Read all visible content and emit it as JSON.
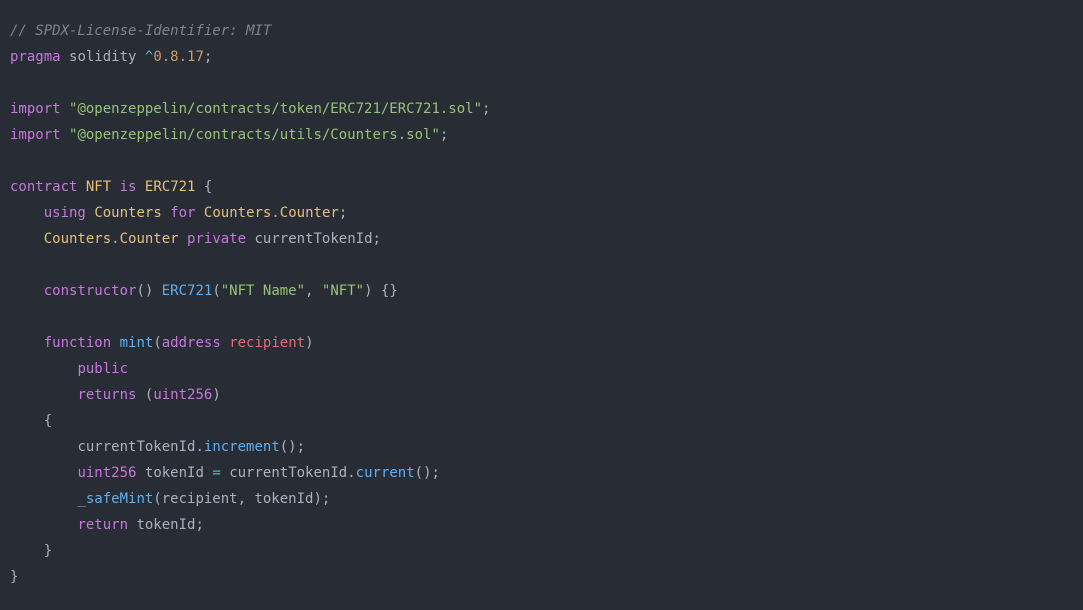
{
  "code": {
    "l1": {
      "comment": "// SPDX-License-Identifier: MIT"
    },
    "l2": {
      "kw1": "pragma",
      "kw2": "solidity",
      "op": "^",
      "ver": "0.8.17",
      "semi": ";"
    },
    "l4": {
      "kw": "import",
      "str": "\"@openzeppelin/contracts/token/ERC721/ERC721.sol\"",
      "semi": ";"
    },
    "l5": {
      "kw": "import",
      "str": "\"@openzeppelin/contracts/utils/Counters.sol\"",
      "semi": ";"
    },
    "l7": {
      "kw1": "contract",
      "name": "NFT",
      "kw2": "is",
      "base": "ERC721",
      "brace": " {"
    },
    "l8": {
      "kw1": "using",
      "lib": "Counters",
      "kw2": "for",
      "type1": "Counters",
      "dot": ".",
      "type2": "Counter",
      "semi": ";"
    },
    "l9": {
      "type1": "Counters",
      "dot": ".",
      "type2": "Counter",
      "vis": "private",
      "name": "currentTokenId",
      "semi": ";"
    },
    "l11": {
      "kw": "constructor",
      "p1": "()",
      "base": "ERC721",
      "p2": "(",
      "s1": "\"NFT Name\"",
      "comma": ", ",
      "s2": "\"NFT\"",
      "p3": ")",
      "body": " {}"
    },
    "l13": {
      "kw": "function",
      "name": "mint",
      "p1": "(",
      "ptype": "address",
      "pname": "recipient",
      "p2": ")"
    },
    "l14": {
      "vis": "public"
    },
    "l15": {
      "kw": "returns",
      "p1": "(",
      "type": "uint256",
      "p2": ")"
    },
    "l16": {
      "brace": "{"
    },
    "l17": {
      "obj": "currentTokenId",
      "dot": ".",
      "fn": "increment",
      "paren": "();"
    },
    "l18": {
      "type": "uint256",
      "var": "tokenId",
      "eq": " = ",
      "obj": "currentTokenId",
      "dot": ".",
      "fn": "current",
      "paren": "();"
    },
    "l19": {
      "fn": "_safeMint",
      "p1": "(",
      "a1": "recipient",
      "comma": ", ",
      "a2": "tokenId",
      "p2": ");"
    },
    "l20": {
      "kw": "return",
      "var": "tokenId",
      "semi": ";"
    },
    "l21": {
      "brace": "}"
    },
    "l22": {
      "brace": "}"
    }
  }
}
